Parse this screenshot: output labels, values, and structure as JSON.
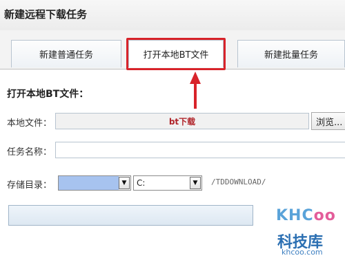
{
  "window": {
    "title": "新建远程下载任务"
  },
  "tabs": [
    {
      "label": "新建普通任务",
      "active": false
    },
    {
      "label": "打开本地BT文件",
      "active": true
    },
    {
      "label": "新建批量任务",
      "active": false
    }
  ],
  "section": {
    "heading": "打开本地BT文件："
  },
  "form": {
    "local_file_label": "本地文件：",
    "local_file_value": "bt下载",
    "browse_label": "浏览...",
    "task_name_label": "任务名称：",
    "task_name_value": "",
    "storage_label": "存储目录：",
    "device_select_value": "",
    "drive_select_value": "C:",
    "path_value": "/TDDOWNLOAD/"
  },
  "annotation": {
    "highlight_color": "#d8232a"
  },
  "watermark": {
    "logo": "KHCoo",
    "logo_prefix": "KHC",
    "logo_suffix": "oo",
    "name": "科技库",
    "url": "khcoo.com"
  },
  "icons": {
    "dropdown": "chevron-down-icon",
    "arrow": "up-arrow-icon"
  }
}
